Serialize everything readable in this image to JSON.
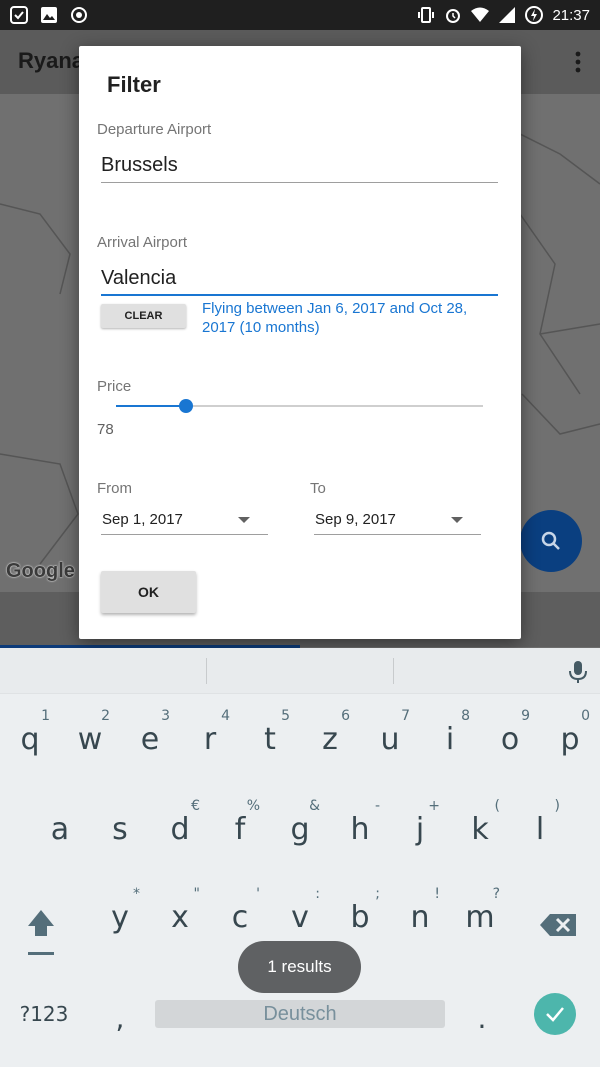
{
  "status_bar": {
    "time": "21:37"
  },
  "app": {
    "title": "Ryana"
  },
  "map": {
    "logo_text": "Google"
  },
  "dialog": {
    "title": "Filter",
    "departure_label": "Departure Airport",
    "departure_value": "Brussels",
    "arrival_label": "Arrival Airport",
    "arrival_value": "Valencia",
    "clear_label": "CLEAR",
    "flying_info": "Flying between Jan 6, 2017 and Oct 28, 2017 (10 months)",
    "price_label": "Price",
    "price_value": "78",
    "price_slider_fraction": 0.19,
    "from_label": "From",
    "from_value": "Sep 1, 2017",
    "to_label": "To",
    "to_value": "Sep 9, 2017",
    "ok_label": "OK"
  },
  "keyboard": {
    "rows": [
      [
        {
          "k": "q",
          "h": "1"
        },
        {
          "k": "w",
          "h": "2"
        },
        {
          "k": "e",
          "h": "3"
        },
        {
          "k": "r",
          "h": "4"
        },
        {
          "k": "t",
          "h": "5"
        },
        {
          "k": "z",
          "h": "6"
        },
        {
          "k": "u",
          "h": "7"
        },
        {
          "k": "i",
          "h": "8"
        },
        {
          "k": "o",
          "h": "9"
        },
        {
          "k": "p",
          "h": "0"
        }
      ],
      [
        {
          "k": "a",
          "h": ""
        },
        {
          "k": "s",
          "h": ""
        },
        {
          "k": "d",
          "h": "€"
        },
        {
          "k": "f",
          "h": "%"
        },
        {
          "k": "g",
          "h": "&"
        },
        {
          "k": "h",
          "h": "-"
        },
        {
          "k": "j",
          "h": "+"
        },
        {
          "k": "k",
          "h": "("
        },
        {
          "k": "l",
          "h": ")"
        }
      ],
      [
        {
          "k": "y",
          "h": "*"
        },
        {
          "k": "x",
          "h": "\""
        },
        {
          "k": "c",
          "h": "'"
        },
        {
          "k": "v",
          "h": ":"
        },
        {
          "k": "b",
          "h": ";"
        },
        {
          "k": "n",
          "h": "!"
        },
        {
          "k": "m",
          "h": "?"
        }
      ]
    ],
    "symbols_label": "?123",
    "comma": ",",
    "period": ".",
    "space_label": "Deutsch"
  },
  "toast": {
    "text": "1 results"
  },
  "colors": {
    "accent": "#1976d2",
    "enter": "#4db6ac",
    "fab": "#0a3f80"
  }
}
